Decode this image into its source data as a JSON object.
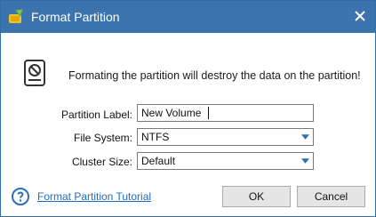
{
  "window": {
    "title": "Format Partition"
  },
  "icons": {
    "app": "minitool-app-icon",
    "close": "close-icon",
    "warning": "drive-prohibited-icon",
    "help": "help-question-icon",
    "dropdown": "chevron-down-icon"
  },
  "message": "Formating the partition will destroy the data on the partition!",
  "form": {
    "partition_label": {
      "label": "Partition Label:",
      "value": "New Volume"
    },
    "file_system": {
      "label": "File System:",
      "value": "NTFS"
    },
    "cluster_size": {
      "label": "Cluster Size:",
      "value": "Default"
    }
  },
  "footer": {
    "tutorial_link": "Format Partition Tutorial",
    "ok_label": "OK",
    "cancel_label": "Cancel"
  },
  "colors": {
    "titlebar": "#3b73ad",
    "link": "#1f6dc2",
    "dropdown_arrow": "#2a6fb7"
  }
}
